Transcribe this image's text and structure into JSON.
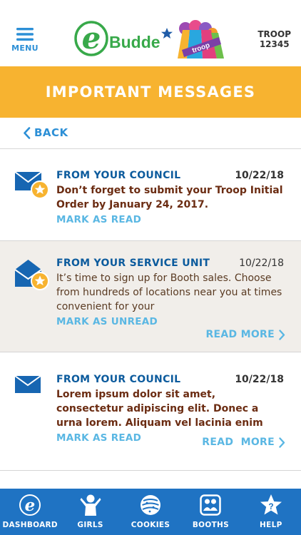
{
  "header": {
    "menu_label": "MENU",
    "logo_e": "e",
    "logo_text": "Budde",
    "logo_badge": "troop",
    "troop_label": "TROOP",
    "troop_number": "12345"
  },
  "title": "IMPORTANT MESSAGES",
  "back_label": "BACK",
  "messages": [
    {
      "from": "FROM YOUR COUNCIL",
      "date": "10/22/18",
      "text": "Don’t forget to submit your Troop Initial Order by January 24, 2017.",
      "action": "MARK AS READ",
      "state": "unread",
      "read_more": ""
    },
    {
      "from": "FROM YOUR SERVICE UNIT",
      "date": "10/22/18",
      "text": "It’s time to sign up for Booth sales. Choose from hundreds of locations near you at times convenient for your",
      "action": "MARK AS UNREAD",
      "state": "read",
      "read_more": "READ MORE"
    },
    {
      "from": "FROM YOUR COUNCIL",
      "date": "10/22/18",
      "text": "Lorem ipsum dolor sit amet, consectetur adipiscing elit. Donec a urna lorem. Aliquam vel lacinia enim",
      "action": "MARK AS READ",
      "state": "unread",
      "read_more": "READ  MORE"
    }
  ],
  "nav": [
    {
      "label": "DASHBOARD",
      "icon": "ebudde-e-icon"
    },
    {
      "label": "GIRLS",
      "icon": "girl-icon"
    },
    {
      "label": "COOKIES",
      "icon": "cookie-icon"
    },
    {
      "label": "BOOTHS",
      "icon": "booth-icon"
    },
    {
      "label": "HELP",
      "icon": "help-star-icon"
    }
  ],
  "colors": {
    "accent_blue": "#2c8fd6",
    "title_bar": "#f7b330",
    "nav_bar": "#1f73c3",
    "link": "#5ab7e3",
    "sender": "#0c5b9d",
    "message_text": "#6b2c12",
    "read_background": "#f1eeea",
    "logo_green": "#38a94a"
  }
}
